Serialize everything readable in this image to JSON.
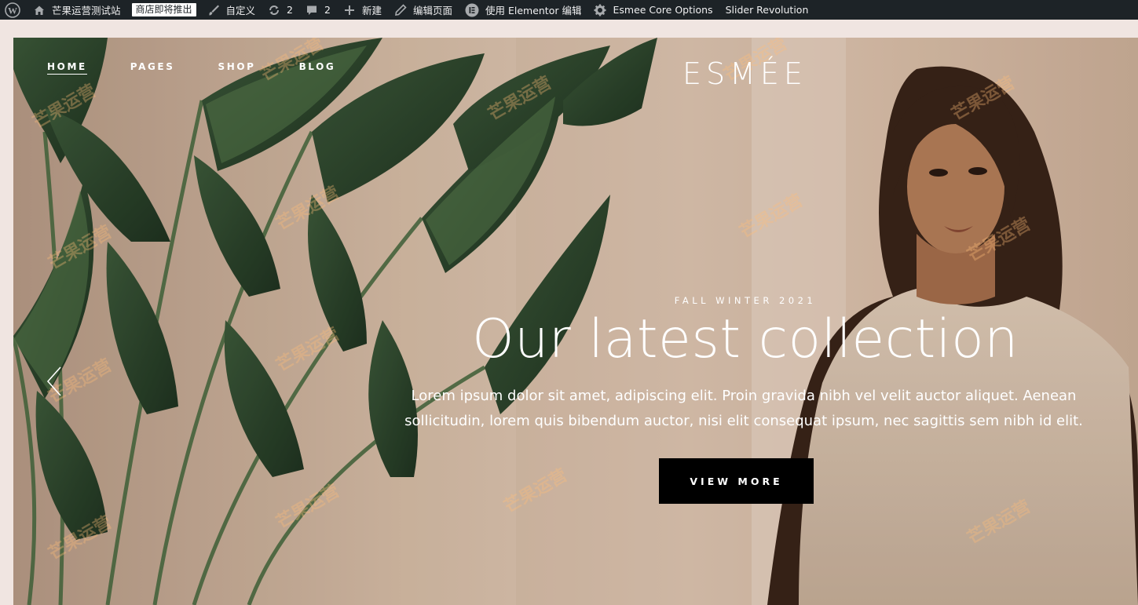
{
  "admin_bar": {
    "site_name": "芒果运营测试站",
    "store_badge": "商店即将推出",
    "customize": "自定义",
    "updates_count": "2",
    "comments_count": "2",
    "new": "新建",
    "edit_page": "编辑页面",
    "elementor": "使用 Elementor 编辑",
    "core_options": "Esmee Core Options",
    "slider": "Slider Revolution"
  },
  "nav": {
    "items": [
      {
        "label": "HOME"
      },
      {
        "label": "PAGES"
      },
      {
        "label": "SHOP"
      },
      {
        "label": "BLOG"
      }
    ]
  },
  "brand": {
    "logo": "ESMÉE"
  },
  "hero": {
    "eyebrow": "FALL WINTER 2021",
    "headline": "Our latest collection",
    "description": "Lorem ipsum dolor sit amet, adipiscing elit. Proin gravida nibh vel velit auctor aliquet. Aenean sollicitudin, lorem quis bibendum auctor, nisi elit consequat ipsum, nec sagittis sem nibh id elit.",
    "cta": "VIEW MORE"
  },
  "watermark": "芒果运营"
}
